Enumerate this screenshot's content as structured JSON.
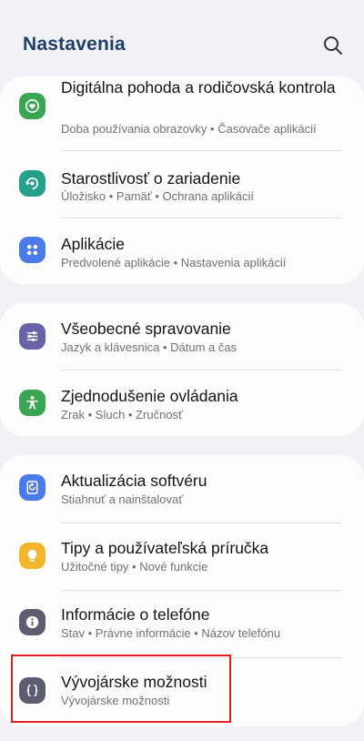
{
  "header": {
    "title": "Nastavenia",
    "search_icon": "search-icon"
  },
  "groups": [
    {
      "items": [
        {
          "label": "Digitálna pohoda a rodičovská kontrola",
          "subtitle": "Doba používania obrazovky • Časovače aplikácií",
          "icon": "digital-wellbeing-icon",
          "color": "#3aa653"
        },
        {
          "label": "Starostlivosť o zariadenie",
          "subtitle": "Úložisko • Pamäť • Ochrana aplikácií",
          "icon": "device-care-icon",
          "color": "#25a08a"
        },
        {
          "label": "Aplikácie",
          "subtitle": "Predvolené aplikácie • Nastavenia aplikácií",
          "icon": "apps-icon",
          "color": "#4a7be8"
        }
      ]
    },
    {
      "items": [
        {
          "label": "Všeobecné spravovanie",
          "subtitle": "Jazyk a klávesnica • Dátum a čas",
          "icon": "sliders-icon",
          "color": "#6a62a8"
        },
        {
          "label": "Zjednodušenie ovládania",
          "subtitle": "Zrak • Sluch • Zručnosť",
          "icon": "accessibility-icon",
          "color": "#3aa653"
        }
      ]
    },
    {
      "items": [
        {
          "label": "Aktualizácia softvéru",
          "subtitle": "Stiahnuť a nainštalovať",
          "icon": "software-update-icon",
          "color": "#4a7be8"
        },
        {
          "label": "Tipy a používateľská príručka",
          "subtitle": "Užitočné tipy • Nové funkcie",
          "icon": "lightbulb-icon",
          "color": "#f3b52c"
        },
        {
          "label": "Informácie o telefóne",
          "subtitle": "Stav • Právne informácie • Názov telefónu",
          "icon": "info-icon",
          "color": "#5d5c70"
        },
        {
          "label": "Vývojárske možnosti",
          "subtitle": "Vývojárske možnosti",
          "icon": "developer-options-icon",
          "color": "#5d5c70"
        }
      ]
    }
  ]
}
